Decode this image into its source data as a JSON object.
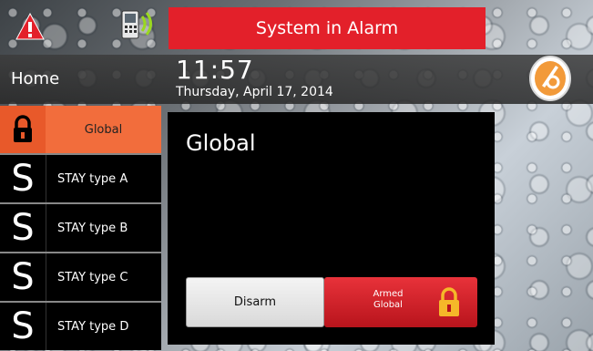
{
  "header": {
    "alarm_banner": "System in Alarm",
    "home_label": "Home",
    "time": "11:57",
    "date": "Thursday, April 17, 2014",
    "icons": [
      "alert-icon",
      "phone-icon",
      "logo"
    ]
  },
  "sidebar": {
    "items": [
      {
        "icon": "lock-icon",
        "label": "Global",
        "active": true
      },
      {
        "icon": "S",
        "label": "STAY   type A"
      },
      {
        "icon": "S",
        "label": "STAY   type B"
      },
      {
        "icon": "S",
        "label": "STAY   type C"
      },
      {
        "icon": "S",
        "label": "STAY   type D"
      }
    ]
  },
  "panel": {
    "title": "Global",
    "disarm_label": "Disarm",
    "armed_line1": "Armed",
    "armed_line2": "Global"
  },
  "colors": {
    "alarm_red": "#e3202a",
    "active_orange": "#f26d3c",
    "armed_red": "#d0202a"
  }
}
